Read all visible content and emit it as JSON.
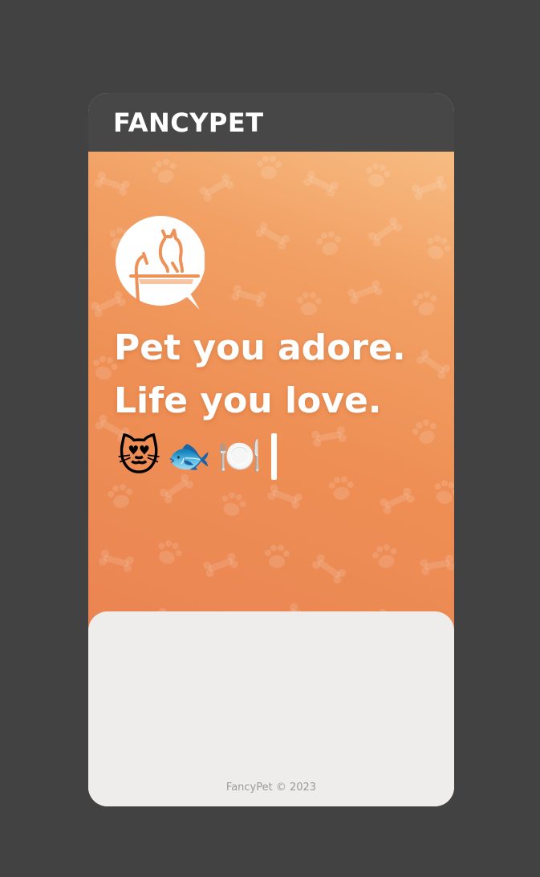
{
  "app": {
    "brand": "FANCYPET"
  },
  "hero": {
    "headline_line1": "Pet you adore.",
    "headline_line2": "Life you love.",
    "emojis": [
      "😻",
      "🐟",
      "🍽️"
    ],
    "logo_icon": "cat-on-perch-chat-bubble-icon"
  },
  "footer": {
    "copyright": "FancyPet © 2023"
  },
  "colors": {
    "background": "#424242",
    "header": "#474747",
    "hero_gradient_top": "#f7bc82",
    "hero_gradient_bottom": "#ea8452",
    "sheet": "#efedeb",
    "text_primary": "#ffffff",
    "footer_text": "#9a9a9a"
  }
}
